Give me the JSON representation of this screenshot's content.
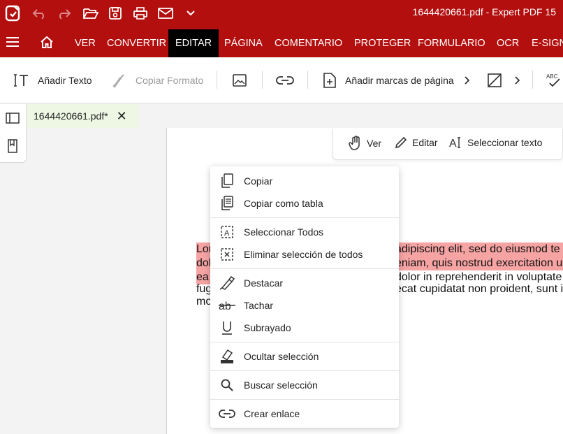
{
  "app": {
    "title": "1644420661.pdf  -  Expert PDF 15"
  },
  "ribbon": {
    "tabs": [
      "VER",
      "CONVERTIR",
      "EDITAR",
      "PÁGINA",
      "COMENTARIO",
      "PROTEGER",
      "FORMULARIO",
      "OCR",
      "E-SIGN"
    ],
    "active_tab": "EDITAR"
  },
  "toolbar": {
    "add_text": "Añadir Texto",
    "copy_format": "Copiar Formato",
    "add_bookmarks": "Añadir marcas de página"
  },
  "document": {
    "tab_name": "1644420661.pdf*",
    "lines": [
      {
        "left": "Lor",
        "right": "adipiscing elit, sed do eiusmod te"
      },
      {
        "left": "dol",
        "right": "eniam, quis nostrud exercitation u"
      },
      {
        "left": "ea",
        "right": "dolor in reprehenderit in voluptate"
      },
      {
        "left": "fug",
        "right": "ecat cupidatat non proident, sunt i"
      },
      {
        "left": "mo",
        "right": ""
      }
    ]
  },
  "modes": {
    "view": "Ver",
    "edit": "Editar",
    "select_text": "Seleccionar texto"
  },
  "context_menu": {
    "copy": "Copiar",
    "copy_table": "Copiar como tabla",
    "select_all": "Seleccionar Todos",
    "deselect_all": "Eliminar selección de todos",
    "highlight": "Destacar",
    "strikeout": "Tachar",
    "underline": "Subrayado",
    "redact": "Ocultar selección",
    "search": "Buscar selección",
    "link": "Crear enlace"
  },
  "colors": {
    "brand_red": "#b30f0f",
    "active_tab": "#000000",
    "highlight": "#f5a3a3",
    "doc_tab_bg": "#eef7e4"
  }
}
